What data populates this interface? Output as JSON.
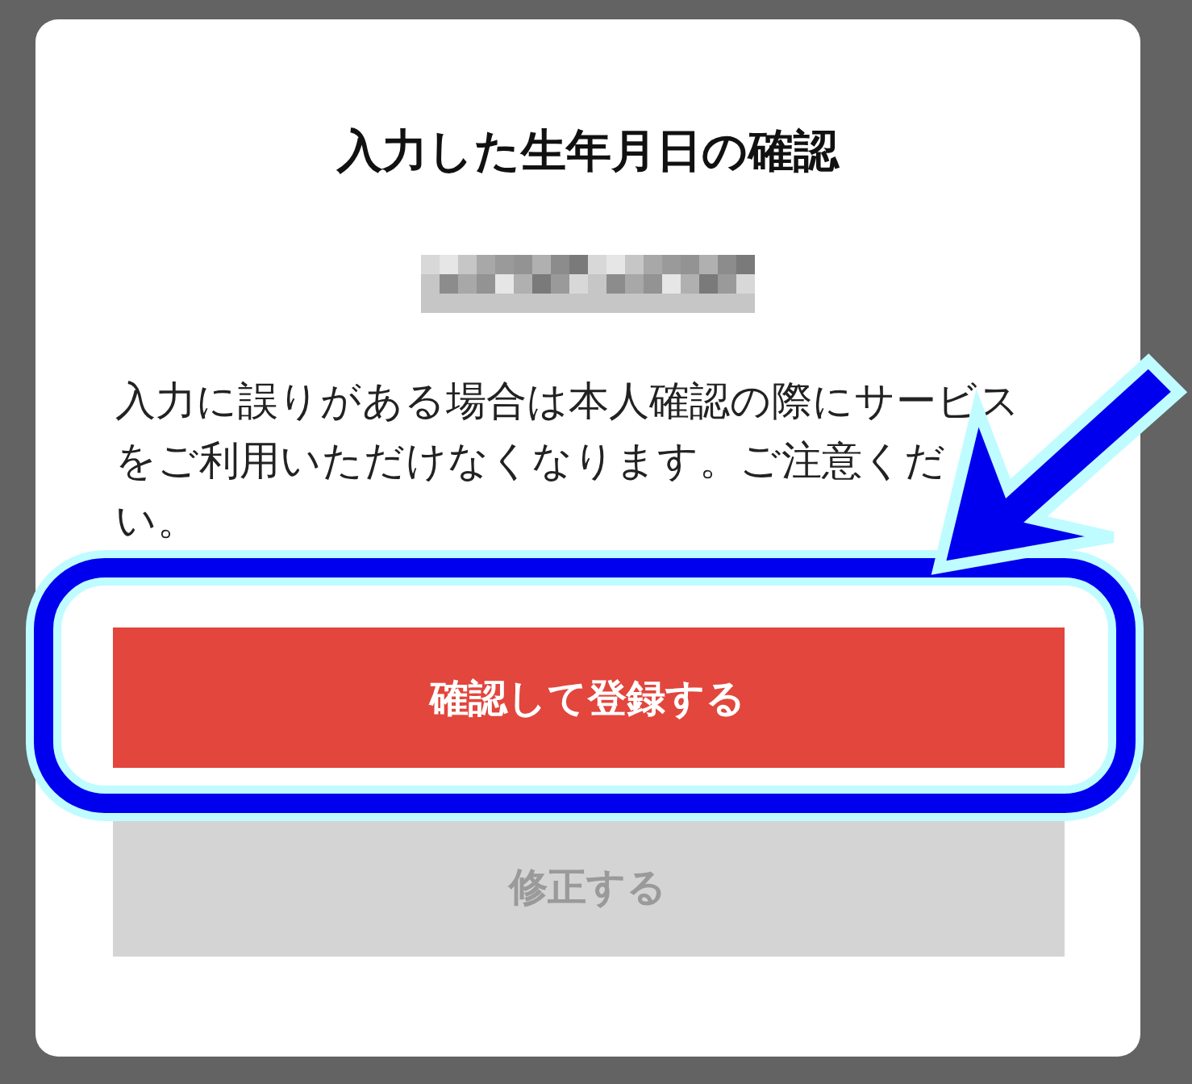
{
  "dialog": {
    "title": "入力した生年月日の確認",
    "message_lines": [
      "入力に誤りがある場合は本人確認の際にサービス",
      "をご利用いただけなくなります。ご注意くだ",
      "い。"
    ],
    "buttons": [
      {
        "label": "確認して登録する",
        "kind": "primary"
      },
      {
        "label": "修正する",
        "kind": "secondary"
      }
    ]
  }
}
